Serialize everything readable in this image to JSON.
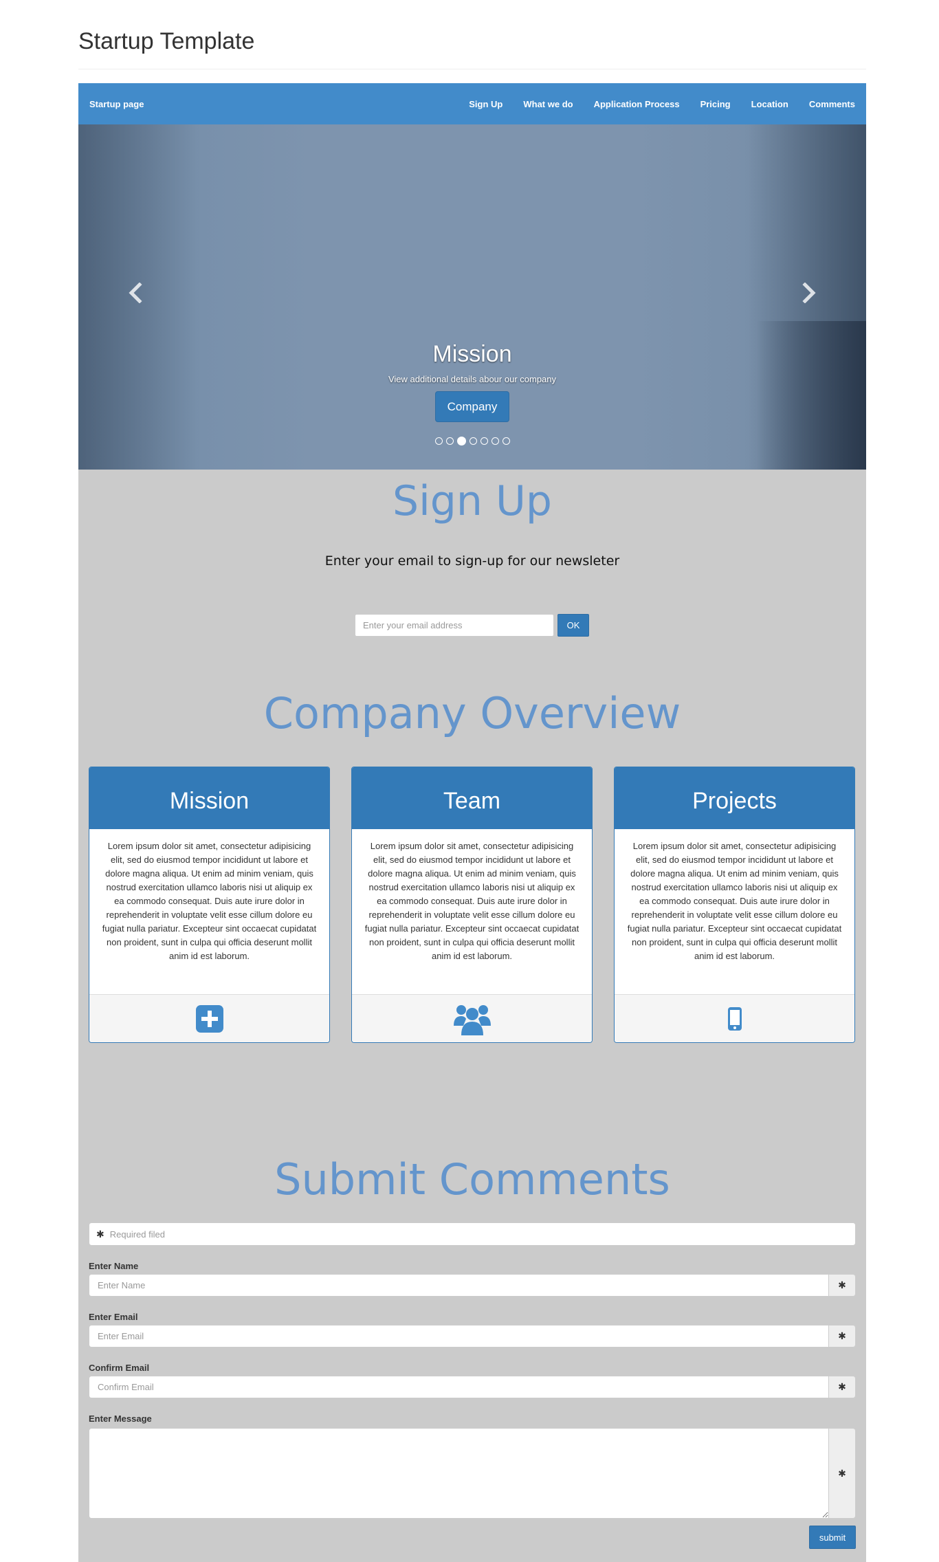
{
  "header": {
    "title": "Startup Template"
  },
  "navbar": {
    "brand": "Startup page",
    "links": [
      "Sign Up",
      "What we do",
      "Application Process",
      "Pricing",
      "Location",
      "Comments"
    ]
  },
  "carousel": {
    "caption_title": "Mission",
    "caption_text": "View additional details abour our company",
    "button_label": "Company",
    "prev_icon": "‹",
    "next_icon": "›",
    "slide_count": 7,
    "active_slide": 3
  },
  "signup": {
    "title": "Sign Up",
    "description": "Enter your email to sign-up for our newsleter",
    "email_placeholder": "Enter your email address",
    "button_label": "OK"
  },
  "overview": {
    "title": "Company Overview",
    "cards": [
      {
        "title": "Mission",
        "body": "Lorem ipsum dolor sit amet, consectetur adipisicing elit, sed do eiusmod tempor incididunt ut labore et dolore magna aliqua. Ut enim ad minim veniam, quis nostrud exercitation ullamco laboris nisi ut aliquip ex ea commodo consequat. Duis aute irure dolor in reprehenderit in voluptate velit esse cillum dolore eu fugiat nulla pariatur. Excepteur sint occaecat cupidatat non proident, sunt in culpa qui officia deserunt mollit anim id est laborum.",
        "icon": "plus-square-icon"
      },
      {
        "title": "Team",
        "body": "Lorem ipsum dolor sit amet, consectetur adipisicing elit, sed do eiusmod tempor incididunt ut labore et dolore magna aliqua. Ut enim ad minim veniam, quis nostrud exercitation ullamco laboris nisi ut aliquip ex ea commodo consequat. Duis aute irure dolor in reprehenderit in voluptate velit esse cillum dolore eu fugiat nulla pariatur. Excepteur sint occaecat cupidatat non proident, sunt in culpa qui officia deserunt mollit anim id est laborum.",
        "icon": "users-icon"
      },
      {
        "title": "Projects",
        "body": "Lorem ipsum dolor sit amet, consectetur adipisicing elit, sed do eiusmod tempor incididunt ut labore et dolore magna aliqua. Ut enim ad minim veniam, quis nostrud exercitation ullamco laboris nisi ut aliquip ex ea commodo consequat. Duis aute irure dolor in reprehenderit in voluptate velit esse cillum dolore eu fugiat nulla pariatur. Excepteur sint occaecat cupidatat non proident, sunt in culpa qui officia deserunt mollit anim id est laborum.",
        "icon": "mobile-phone-icon"
      }
    ]
  },
  "comments": {
    "title": "Submit Comments",
    "required_note": "Required filed",
    "fields": [
      {
        "label": "Enter Name",
        "placeholder": "Enter Name"
      },
      {
        "label": "Enter Email",
        "placeholder": "Enter Email"
      },
      {
        "label": "Confirm Email",
        "placeholder": "Confirm Email"
      }
    ],
    "message_label": "Enter Message",
    "asterisk": "✱",
    "submit_label": "submit"
  },
  "colors": {
    "nav_blue": "#428bca",
    "primary": "#337ab7",
    "title_blue": "#6495cc",
    "content_bg": "#cbcbcb"
  }
}
